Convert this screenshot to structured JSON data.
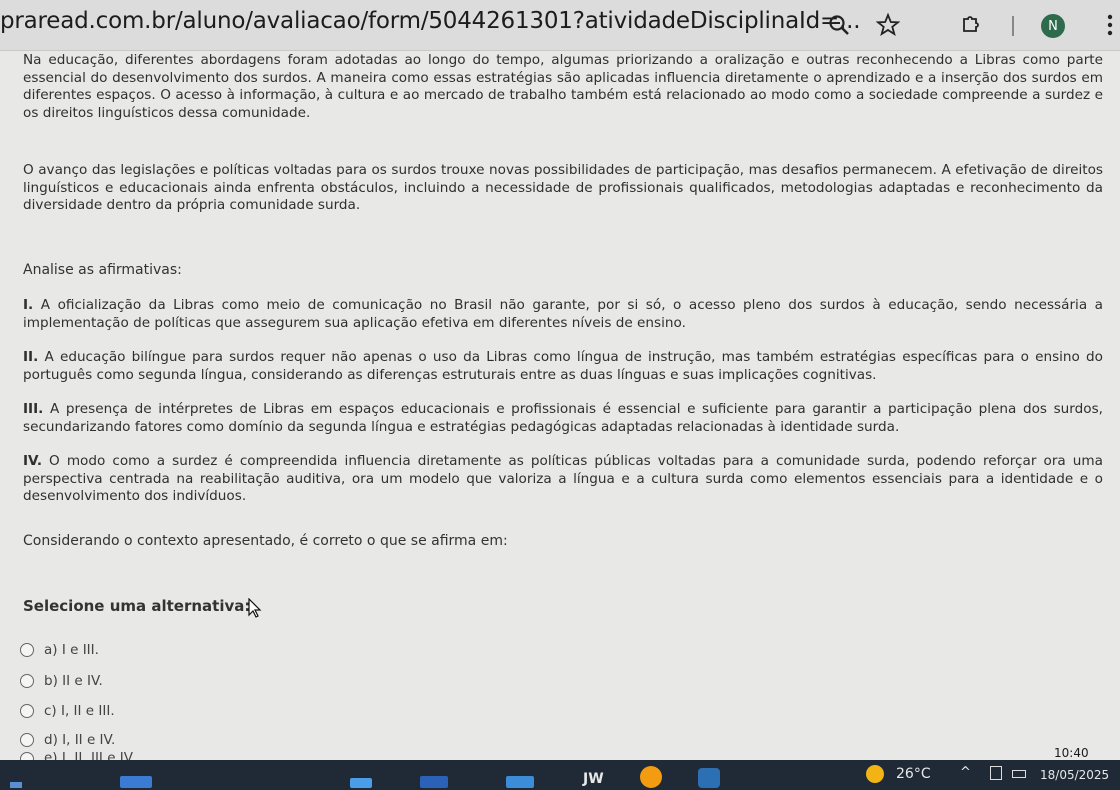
{
  "browser": {
    "url": "praread.com.br/aluno/avaliacao/form/5044261301?atividadeDisciplinaId=...",
    "avatar_letter": "N"
  },
  "question": {
    "context_p1": "Na educação, diferentes abordagens foram adotadas ao longo do tempo, algumas priorizando a oralização e outras reconhecendo a Libras como parte essencial do desenvolvimento dos surdos. A maneira como essas estratégias são aplicadas influencia diretamente o aprendizado e a inserção dos surdos em diferentes espaços. O acesso à informação, à cultura e ao mercado de trabalho também está relacionado ao modo como a sociedade compreende a surdez e os direitos linguísticos dessa comunidade.",
    "context_p2": "O avanço das legislações e políticas voltadas para os surdos trouxe novas possibilidades de participação, mas desafios permanecem. A efetivação de direitos linguísticos e educacionais ainda enfrenta obstáculos, incluindo a necessidade de profissionais qualificados, metodologias adaptadas e reconhecimento da diversidade dentro da própria comunidade surda.",
    "analyze_label": "Analise as afirmativas:",
    "statements": [
      {
        "num": "I.",
        "text": " A oficialização da Libras como meio de comunicação no Brasil não garante, por si só, o acesso pleno dos surdos à educação, sendo necessária a implementação de políticas que assegurem sua aplicação efetiva em diferentes níveis de ensino."
      },
      {
        "num": "II.",
        "text": " A educação bilíngue para surdos requer não apenas o uso da Libras como língua de instrução, mas também estratégias específicas para o ensino do português como segunda língua, considerando as diferenças estruturais entre as duas línguas e suas implicações cognitivas."
      },
      {
        "num": "III.",
        "text": " A presença de intérpretes de Libras em espaços educacionais e profissionais é essencial e suficiente para garantir a participação plena dos surdos, secundarizando fatores como domínio da segunda língua e estratégias pedagógicas adaptadas relacionadas à identidade surda."
      },
      {
        "num": "IV.",
        "text": " O modo como a surdez é compreendida influencia diretamente as políticas públicas voltadas para a comunidade surda, podendo reforçar ora uma perspectiva centrada na reabilitação auditiva, ora um modelo que valoriza a língua e a cultura surda como elementos essenciais para a identidade e o desenvolvimento dos indivíduos."
      }
    ],
    "prompt": "Considerando o contexto apresentado, é correto o que se afirma em:",
    "select_title": "Selecione uma alternativa:",
    "options": [
      "a) I e III.",
      "b) II e IV.",
      "c) I, II e III.",
      "d) I, II e IV.",
      "e) I, II, III e IV."
    ]
  },
  "taskbar": {
    "weather": "26°C",
    "time": "10:40",
    "date": "18/05/2025",
    "app_label": "JW"
  }
}
